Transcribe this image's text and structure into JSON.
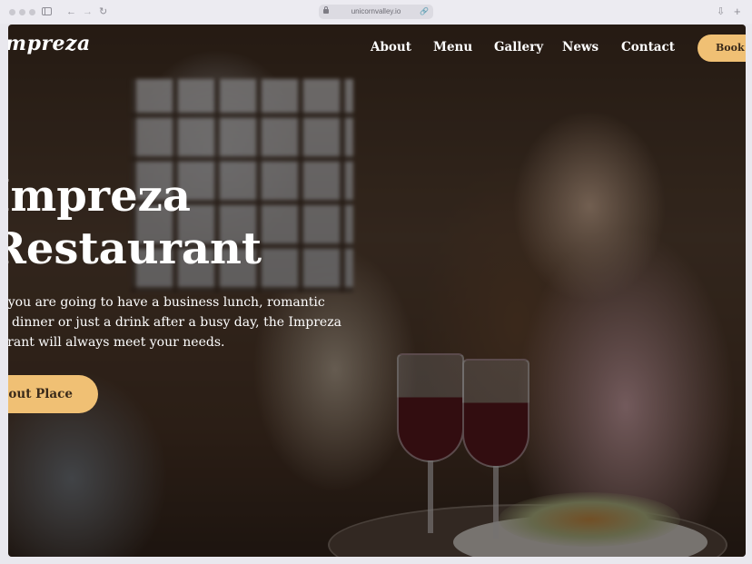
{
  "browser": {
    "url": "unicornvalley.io",
    "icons": [
      "sidebar-icon",
      "back-icon",
      "forward-icon",
      "reload-icon",
      "lock-icon",
      "link-icon",
      "download-icon",
      "new-tab-icon"
    ]
  },
  "site": {
    "logo": "Impreza",
    "nav": {
      "about": "About",
      "menu": "Menu",
      "gallery": "Gallery",
      "news": "News",
      "contact": "Contact"
    },
    "book_button": "Book T",
    "accent_color": "#f0c074"
  },
  "hero": {
    "title_line1": "Impreza",
    "title_line2": "Restaurant",
    "desc_line1": "Whether you are going to have a business lunch, romantic",
    "desc_line2": "candlelight dinner or just a drink after a busy day, the Impreza",
    "desc_line3": "restaurant will always meet your needs.",
    "cta": "About Place"
  }
}
